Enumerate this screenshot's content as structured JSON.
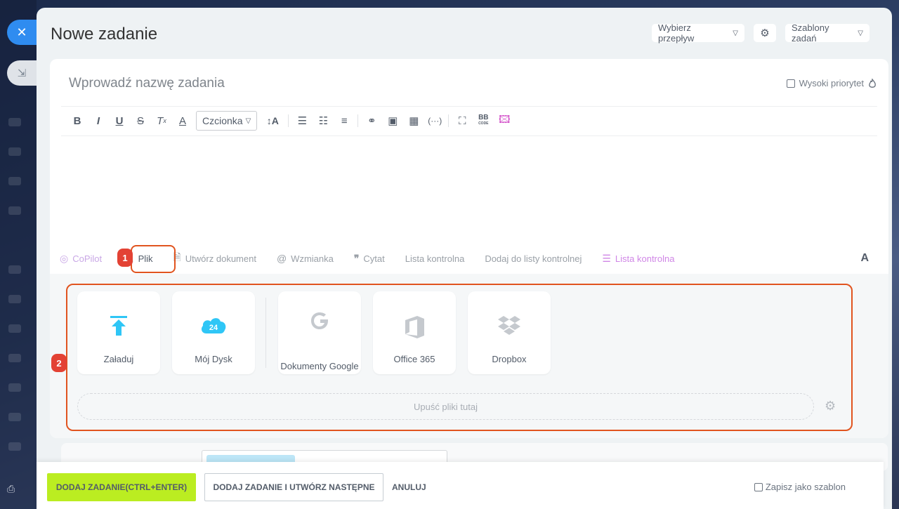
{
  "header": {
    "title": "Nowe zadanie",
    "flow_label": "Wybierz przepływ",
    "templates_label": "Szablony zadań"
  },
  "task": {
    "name_placeholder": "Wprowadź nazwę zadania",
    "priority_label": "Wysoki priorytet"
  },
  "toolbar": {
    "font_label": "Czcionka",
    "bbcode_label": "BB"
  },
  "attach_bar": {
    "copilot": "CoPilot",
    "file": "Plik",
    "create_document": "Utwórz dokument",
    "mention": "Wzmianka",
    "quote": "Cytat",
    "checklist": "Lista kontrolna",
    "add_to_checklist": "Dodaj do listy kontrolnej",
    "checklist_ai": "Lista kontrolna",
    "font_toggle": "A"
  },
  "badges": {
    "one": "1",
    "two": "2"
  },
  "upload": {
    "tiles": [
      "Załaduj",
      "Mój Dysk",
      "Dokumenty Google",
      "Office 365",
      "Dropbox"
    ],
    "drive_badge": "24",
    "drop_text": "Upuść pliki tutaj"
  },
  "footer": {
    "add_task": "DODAJ ZADANIE(CTRL+ENTER)",
    "add_and_next": "DODAJ ZADANIE I UTWÓRZ NASTĘPNE",
    "cancel": "ANULUJ",
    "save_template": "Zapisz jako szablon"
  },
  "colors": {
    "primary_button": "#bbed21",
    "highlight_outline": "#e1541f",
    "badge": "#e34234",
    "upload_icon": "#2fc6f6",
    "close_button": "#2f8cf0"
  }
}
